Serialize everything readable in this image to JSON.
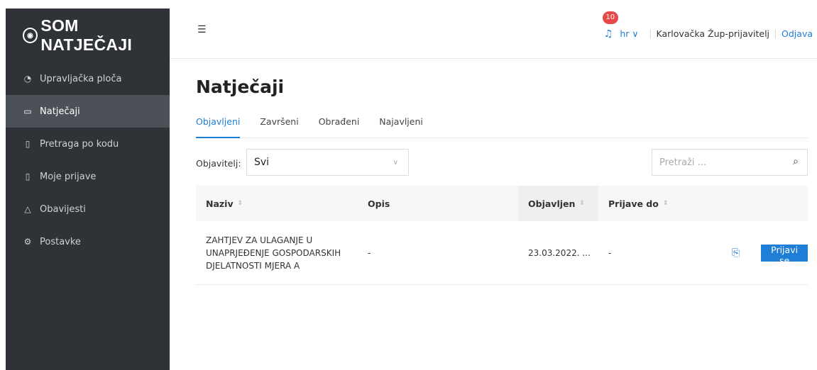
{
  "brand": {
    "name": "SOM NATJEČAJI"
  },
  "sidebar": {
    "items": [
      {
        "label": "Upravljačka ploča",
        "icon": "dashboard-icon"
      },
      {
        "label": "Natječaji",
        "icon": "folder-icon",
        "active": true
      },
      {
        "label": "Pretraga po kodu",
        "icon": "file-search-icon"
      },
      {
        "label": "Moje prijave",
        "icon": "document-icon"
      },
      {
        "label": "Obavijesti",
        "icon": "bell-icon"
      },
      {
        "label": "Postavke",
        "icon": "gear-icon"
      }
    ]
  },
  "header": {
    "notifications_count": "10",
    "language": "hr ∨",
    "user": "Karlovačka Žup-prijavitelj",
    "logout": "Odjava"
  },
  "page": {
    "title": "Natječaji",
    "tabs": [
      "Objavljeni",
      "Završeni",
      "Obrađeni",
      "Najavljeni"
    ],
    "active_tab": "Objavljeni"
  },
  "filters": {
    "publisher_label": "Objavitelj:",
    "publisher_value": "Svi",
    "search_placeholder": "Pretraži ..."
  },
  "table": {
    "headers": [
      "Naziv",
      "Opis",
      "Objavljen",
      "Prijave do"
    ],
    "rows": [
      {
        "naziv": "ZAHTJEV ZA ULAGANJE U UNAPRJEĐENJE GOSPODARSKIH DJELATNOSTI MJERA A",
        "opis": "-",
        "objavljen": "23.03.2022. ...",
        "prijave_do": "-",
        "action_label": "Prijavi se"
      }
    ]
  },
  "colors": {
    "primary": "#1f7ed6",
    "sidebar_bg": "#2f3237",
    "badge": "#e74848"
  }
}
